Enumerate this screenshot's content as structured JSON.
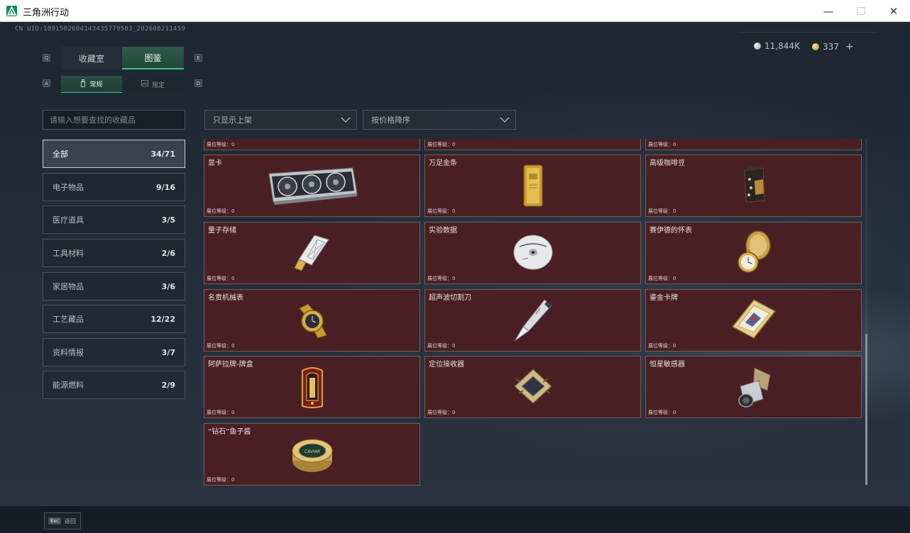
{
  "window": {
    "title": "三角洲行动",
    "minimize_glyph": "—",
    "maximize_glyph": "☐",
    "close_glyph": "✕"
  },
  "uid_text": "CN UID:1891502604143435779583_202608211459",
  "currency": [
    {
      "icon": "silver-coin-icon",
      "value": "11,844K"
    },
    {
      "icon": "gold-coin-icon",
      "value": "337",
      "plus": "+"
    }
  ],
  "key_hints": {
    "left_main": "Q",
    "right_main": "E",
    "left_sub": "A",
    "right_sub": "D"
  },
  "tabs": [
    {
      "label": "收藏室",
      "active": false
    },
    {
      "label": "图鉴",
      "active": true
    }
  ],
  "subtabs": [
    {
      "label": "常规",
      "icon": "bottle-icon",
      "active": true
    },
    {
      "label": "限定",
      "icon": "image-icon",
      "active": false
    }
  ],
  "search": {
    "placeholder": "请输入想要查找的收藏品"
  },
  "filters": [
    {
      "label": "只显示上架"
    },
    {
      "label": "按价格降序"
    }
  ],
  "categories": [
    {
      "label": "全部",
      "count": "34/71",
      "active": true
    },
    {
      "label": "电子物品",
      "count": "9/16"
    },
    {
      "label": "医疗道具",
      "count": "3/5"
    },
    {
      "label": "工具材料",
      "count": "2/6"
    },
    {
      "label": "家居物品",
      "count": "3/6"
    },
    {
      "label": "工艺藏品",
      "count": "12/22"
    },
    {
      "label": "资料情报",
      "count": "3/7"
    },
    {
      "label": "能源燃料",
      "count": "2/9"
    }
  ],
  "items": [
    {
      "name": "",
      "level": "展位等级：0",
      "icon": "partial-item-icon"
    },
    {
      "name": "",
      "level": "展位等级：0",
      "icon": "partial-item-icon"
    },
    {
      "name": "",
      "level": "展位等级：0",
      "icon": "partial-item-icon"
    },
    {
      "name": "显卡",
      "level": "展位等级：0",
      "icon": "graphics-card-icon"
    },
    {
      "name": "万足金条",
      "level": "展位等级：0",
      "icon": "gold-bar-icon"
    },
    {
      "name": "高级咖啡豆",
      "level": "展位等级：0",
      "icon": "coffee-bag-icon"
    },
    {
      "name": "量子存储",
      "level": "展位等级：0",
      "icon": "usb-drive-icon"
    },
    {
      "name": "实验数据",
      "level": "展位等级：0",
      "icon": "disc-icon"
    },
    {
      "name": "赛伊德的怀表",
      "level": "展位等级：0",
      "icon": "pocket-watch-icon"
    },
    {
      "name": "名贵机械表",
      "level": "展位等级：0",
      "icon": "wristwatch-icon"
    },
    {
      "name": "超声波切割刀",
      "level": "展位等级：0",
      "icon": "cutter-knife-icon"
    },
    {
      "name": "鎏金卡牌",
      "level": "展位等级：0",
      "icon": "gold-card-icon"
    },
    {
      "name": "阿萨拉牌-牌盒",
      "level": "展位等级：0",
      "icon": "card-box-icon"
    },
    {
      "name": "定位接收器",
      "level": "展位等级：0",
      "icon": "receiver-icon"
    },
    {
      "name": "恒星敏感器",
      "level": "展位等级：0",
      "icon": "star-sensor-icon"
    },
    {
      "name": "“钻石”鱼子酱",
      "level": "展位等级：0",
      "icon": "caviar-tin-icon",
      "tin_label": "CAVIAR"
    }
  ],
  "footer": {
    "esc_key": "Esc",
    "esc_label": "返回"
  }
}
